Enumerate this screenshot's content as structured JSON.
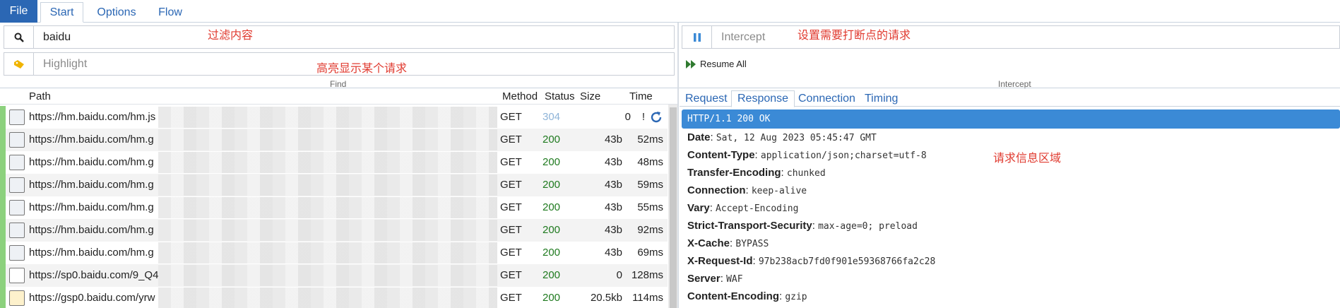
{
  "menu": {
    "file_label": "File",
    "tabs": [
      "Start",
      "Options",
      "Flow"
    ]
  },
  "find": {
    "filter_value": "baidu",
    "highlight_placeholder": "Highlight",
    "section_label": "Find",
    "note_filter": "过滤内容",
    "note_highlight": "高亮显示某个请求"
  },
  "intercept": {
    "placeholder": "Intercept",
    "note": "设置需要打断点的请求",
    "resume_label": "Resume All",
    "section_label": "Intercept"
  },
  "list": {
    "headers": {
      "path": "Path",
      "method": "Method",
      "status": "Status",
      "size": "Size",
      "time": "Time"
    },
    "rows": [
      {
        "path": "https://hm.baidu.com/hm.js",
        "method": "GET",
        "status": "304",
        "size": "0",
        "time": "!"
      },
      {
        "path": "https://hm.baidu.com/hm.g",
        "method": "GET",
        "status": "200",
        "size": "43b",
        "time": "52ms"
      },
      {
        "path": "https://hm.baidu.com/hm.g",
        "method": "GET",
        "status": "200",
        "size": "43b",
        "time": "48ms"
      },
      {
        "path": "https://hm.baidu.com/hm.g",
        "method": "GET",
        "status": "200",
        "size": "43b",
        "time": "59ms"
      },
      {
        "path": "https://hm.baidu.com/hm.g",
        "method": "GET",
        "status": "200",
        "size": "43b",
        "time": "55ms"
      },
      {
        "path": "https://hm.baidu.com/hm.g",
        "method": "GET",
        "status": "200",
        "size": "43b",
        "time": "92ms"
      },
      {
        "path": "https://hm.baidu.com/hm.g",
        "method": "GET",
        "status": "200",
        "size": "43b",
        "time": "69ms"
      },
      {
        "path": "https://sp0.baidu.com/9_Q4",
        "method": "GET",
        "status": "200",
        "size": "0",
        "time": "128ms"
      },
      {
        "path": "https://gsp0.baidu.com/yrw",
        "method": "GET",
        "status": "200",
        "size": "20.5kb",
        "time": "114ms"
      }
    ]
  },
  "detail": {
    "tabs": [
      "Request",
      "Response",
      "Connection",
      "Timing"
    ],
    "status_line": "HTTP/1.1 200 OK",
    "note": "请求信息区域",
    "headers": [
      {
        "key": "Date",
        "value": "Sat, 12 Aug 2023 05:45:47 GMT"
      },
      {
        "key": "Content-Type",
        "value": "application/json;charset=utf-8"
      },
      {
        "key": "Transfer-Encoding",
        "value": "chunked"
      },
      {
        "key": "Connection",
        "value": "keep-alive"
      },
      {
        "key": "Vary",
        "value": "Accept-Encoding"
      },
      {
        "key": "Strict-Transport-Security",
        "value": "max-age=0; preload"
      },
      {
        "key": "X-Cache",
        "value": "BYPASS"
      },
      {
        "key": "X-Request-Id",
        "value": "97b238acb7fd0f901e59368766fa2c28"
      },
      {
        "key": "Server",
        "value": "WAF"
      },
      {
        "key": "Content-Encoding",
        "value": "gzip"
      }
    ]
  },
  "colors": {
    "accent": "#2b67b4",
    "ok_status": "#1f7a1f",
    "note_red": "#e03a2f",
    "highlight_blue": "#3b8ad6"
  }
}
